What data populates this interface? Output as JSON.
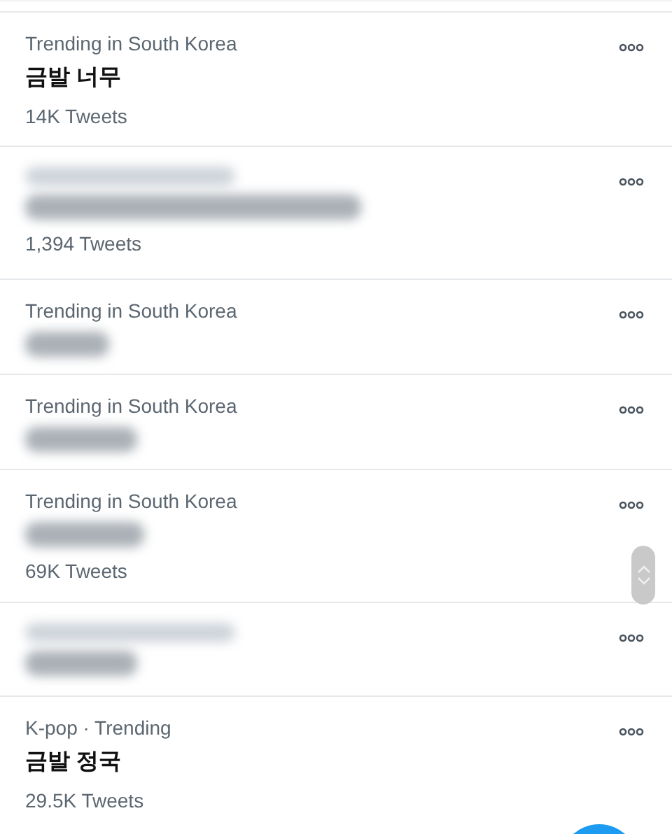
{
  "trends": [
    {
      "category": {
        "kind": "text",
        "text": "Trending in South Korea"
      },
      "title": {
        "kind": "text",
        "text": "금발 너무"
      },
      "count": "14K Tweets"
    },
    {
      "category": {
        "kind": "blurred"
      },
      "title": {
        "kind": "blurred"
      },
      "count": "1,394 Tweets"
    },
    {
      "category": {
        "kind": "text",
        "text": "Trending in South Korea"
      },
      "title": {
        "kind": "blurred"
      }
    },
    {
      "category": {
        "kind": "text",
        "text": "Trending in South Korea"
      },
      "title": {
        "kind": "blurred"
      }
    },
    {
      "category": {
        "kind": "text",
        "text": "Trending in South Korea"
      },
      "title": {
        "kind": "blurred"
      },
      "count": "69K Tweets"
    },
    {
      "category": {
        "kind": "blurred"
      },
      "title": {
        "kind": "blurred"
      }
    },
    {
      "category": {
        "kind": "text",
        "text": "K-pop · Trending"
      },
      "title": {
        "kind": "text",
        "text": "금발 정국"
      },
      "count": "29.5K Tweets"
    }
  ]
}
